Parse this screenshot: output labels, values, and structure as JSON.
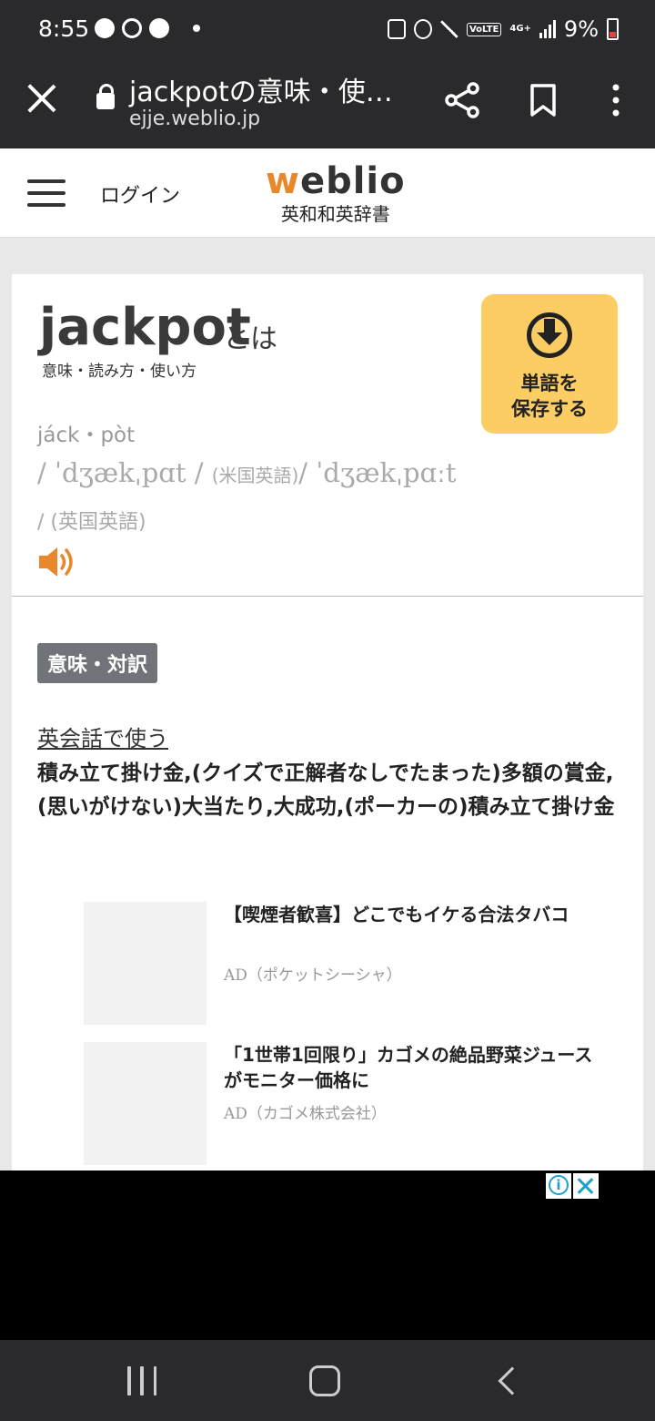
{
  "status_bar": {
    "time": "8:55",
    "network": "4G+",
    "volte": "VoLTE",
    "battery_percent": "9%"
  },
  "tab_bar": {
    "title": "jackpotの意味・使…",
    "url": "ejje.weblio.jp"
  },
  "site_header": {
    "login": "ログイン",
    "logo_w": "w",
    "logo_rest": "eblio",
    "logo_sub": "英和和英辞書"
  },
  "entry": {
    "word": "jackpot",
    "toha": "とは",
    "subtitle": "意味・読み方・使い方",
    "save_button_line1": "単語を",
    "save_button_line2": "保存する",
    "syllabification": "jáck・pòt",
    "pron_us": "/ ˈdʒækˌpɑt /",
    "pron_us_tag": "(米国英語)",
    "pron_uk": "/ ˈdʒækˌpɑːt",
    "pron_uk_tag": "/ (英国英語)",
    "section_label": "意味・対訳",
    "eikaiwa_link": "英会話で使う",
    "meaning": "積み立て掛け金,(クイズで正解者なしでたまった)多額の賞金,(思いがけない)大当たり,大成功,(ポーカーの)積み立て掛け金"
  },
  "ads": [
    {
      "title": "【喫煙者歓喜】どこでもイケる合法タバコ",
      "source": "AD（ポケットシーシャ）"
    },
    {
      "title": "「1世帯1回限り」カゴメの絶品野菜ジュースがモニター価格に",
      "source": "AD（カゴメ株式会社）"
    }
  ],
  "colors": {
    "logo_accent": "#e9882b",
    "save_button": "#fccd63",
    "section_label_bg": "#707377",
    "ad_choices": "#1ea1c8"
  }
}
